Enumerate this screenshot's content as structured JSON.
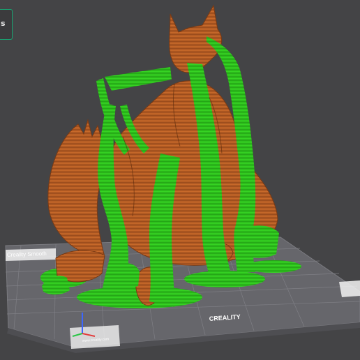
{
  "plate": {
    "brand_top_left": "Creality Smooth",
    "brand_center": "CREALITY",
    "brand_bottom_left": "www.creality.com"
  },
  "side_button": {
    "label": "s"
  },
  "colors": {
    "background": "#444446",
    "model": "#c8692a",
    "support": "#33d11f",
    "plate": "#6b6b70",
    "grid": "#8a8a90",
    "accent": "#17a673"
  }
}
